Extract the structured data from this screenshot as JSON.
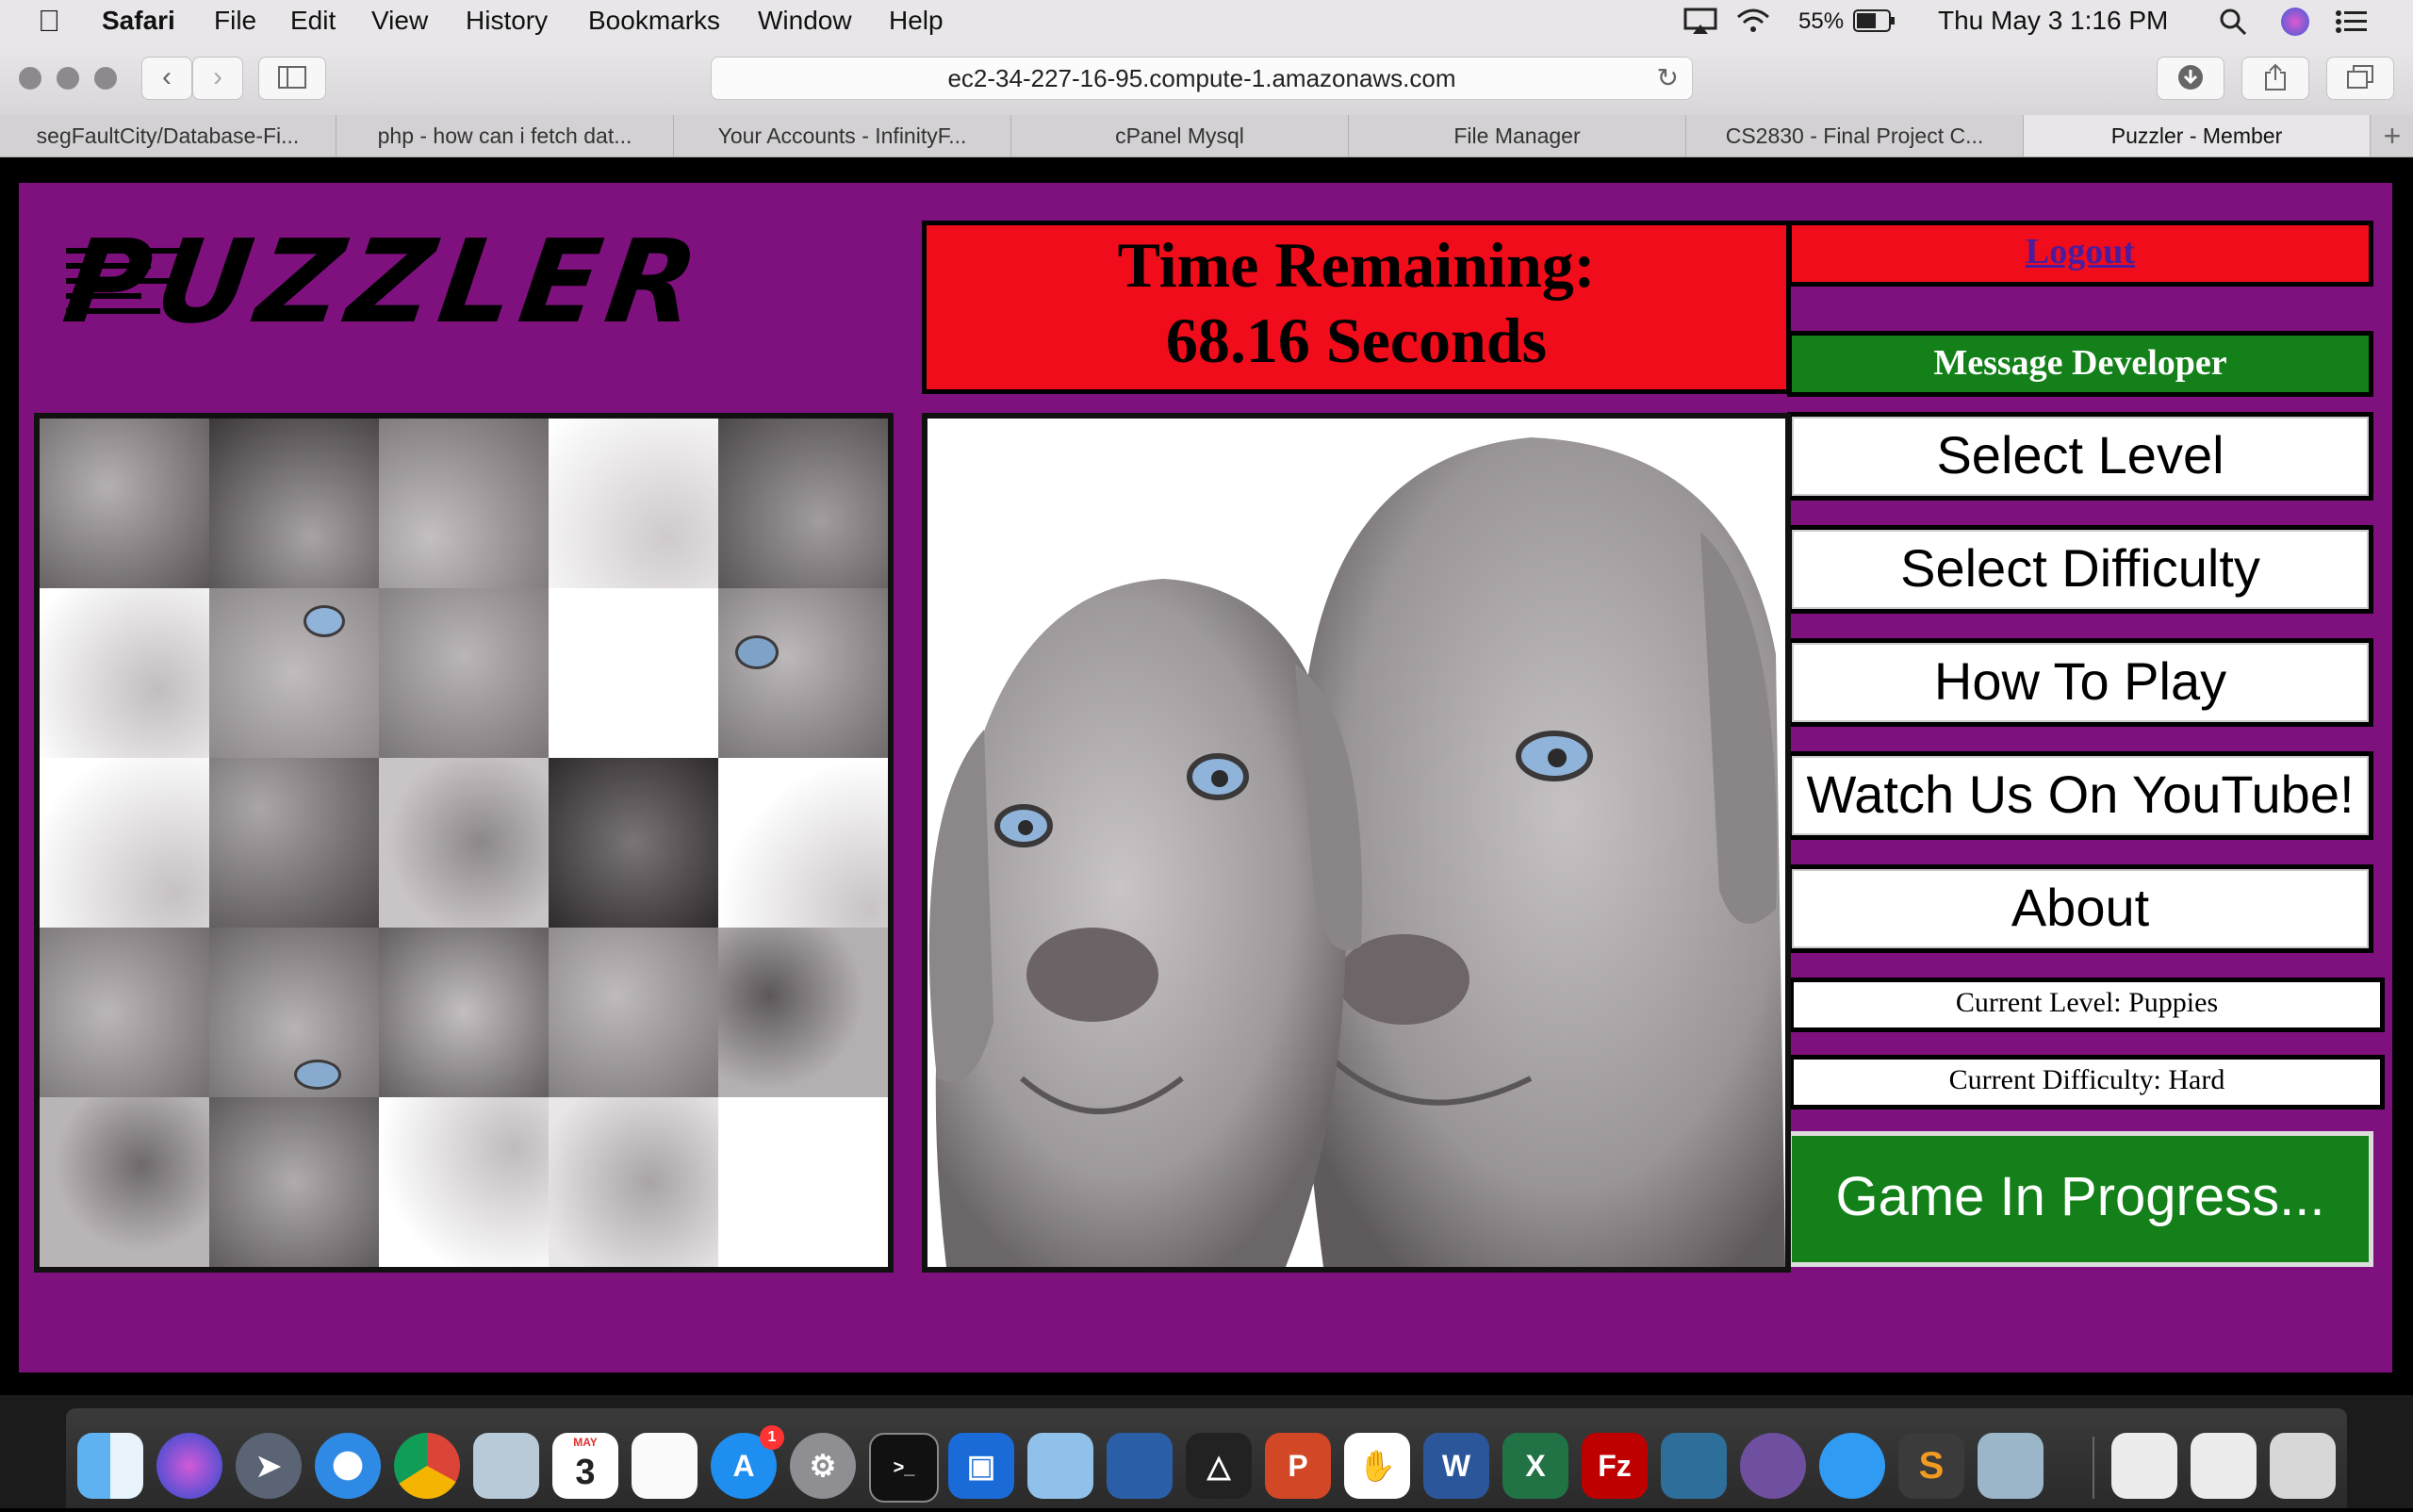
{
  "menubar": {
    "apple": "",
    "items": [
      "Safari",
      "File",
      "Edit",
      "View",
      "History",
      "Bookmarks",
      "Window",
      "Help"
    ],
    "battery": "55%",
    "datetime": "Thu May 3  1:16 PM"
  },
  "toolbar": {
    "url": "ec2-34-227-16-95.compute-1.amazonaws.com"
  },
  "tabs": [
    {
      "label": "segFaultCity/Database-Fi..."
    },
    {
      "label": "php - how can i fetch dat..."
    },
    {
      "label": "Your Accounts - InfinityF..."
    },
    {
      "label": "cPanel Mysql"
    },
    {
      "label": "File Manager"
    },
    {
      "label": "CS2830 - Final Project C..."
    },
    {
      "label": "Puzzler - Member"
    }
  ],
  "game": {
    "logo": "PUZZLER",
    "timer_line1": "Time Remaining:",
    "timer_line2": "68.16 Seconds",
    "logout": "Logout",
    "message_developer": "Message Developer",
    "menu": [
      "Select Level",
      "Select Difficulty",
      "How To Play",
      "Watch Us On YouTube!",
      "About"
    ],
    "current_level": "Current Level: Puppies",
    "current_difficulty": "Current Difficulty: Hard",
    "status_button": "Game In Progress..."
  },
  "colors": {
    "page_bg": "#7f117f",
    "timer_bg": "#f00c1a",
    "green": "#13801a"
  },
  "dock": {
    "calendar_month": "MAY",
    "calendar_day": "3",
    "appstore_badge": "1"
  }
}
